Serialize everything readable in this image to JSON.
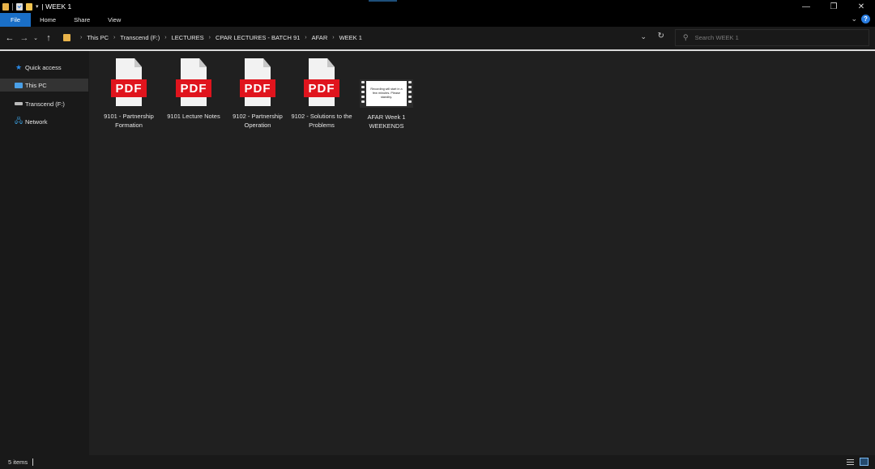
{
  "window": {
    "title": "| WEEK 1",
    "minimize_glyph": "—",
    "restore_glyph": "❐",
    "close_glyph": "✕"
  },
  "ribbon": {
    "tabs": [
      {
        "label": "File",
        "active": true
      },
      {
        "label": "Home"
      },
      {
        "label": "Share"
      },
      {
        "label": "View"
      }
    ],
    "help_label": "?"
  },
  "nav_buttons": {
    "back": "←",
    "forward": "→",
    "recent": "⌄",
    "up": "↑"
  },
  "address": {
    "breadcrumbs": [
      "This PC",
      "Transcend (F:)",
      "LECTURES",
      "CPAR LECTURES - BATCH 91",
      "AFAR",
      "WEEK 1"
    ],
    "separator": "›",
    "dropdown_glyph": "⌄",
    "refresh_glyph": "↻"
  },
  "search": {
    "placeholder": "Search WEEK 1",
    "value": ""
  },
  "navpane": {
    "items": [
      {
        "label": "Quick access",
        "icon": "star-icon",
        "glyph": "★"
      },
      {
        "label": "This PC",
        "icon": "computer-icon",
        "selected": true
      },
      {
        "label": "Transcend (F:)",
        "icon": "drive-icon"
      },
      {
        "label": "Network",
        "icon": "network-icon",
        "glyph": "🖧"
      }
    ]
  },
  "files": [
    {
      "name": "9101 - Partnership Formation",
      "type": "pdf",
      "badge": "PDF"
    },
    {
      "name": "9101 Lecture Notes",
      "type": "pdf",
      "badge": "PDF"
    },
    {
      "name": "9102 - Partnership Operation",
      "type": "pdf",
      "badge": "PDF"
    },
    {
      "name": "9102 - Solutions to the Problems",
      "type": "pdf",
      "badge": "PDF"
    },
    {
      "name": "AFAR Week 1 WEEKENDS",
      "type": "video",
      "thumbnail_text": "Recording will start in a few minutes. Please standby."
    }
  ],
  "status": {
    "item_count": "5 items"
  },
  "colors": {
    "accent": "#1a6fc7",
    "pdf_red": "#e0141d",
    "folder_yellow": "#e8b34a",
    "content_bg": "#202020"
  }
}
